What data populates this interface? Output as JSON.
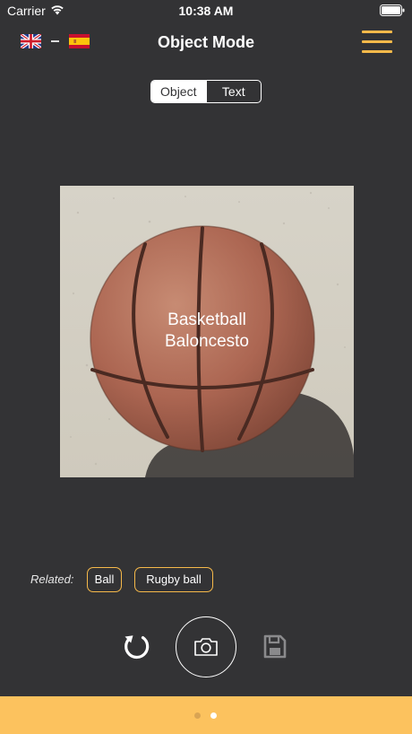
{
  "status_bar": {
    "carrier": "Carrier",
    "time": "10:38 AM"
  },
  "nav": {
    "title": "Object Mode",
    "source_language_flag": "uk-flag",
    "target_language_flag": "spain-flag"
  },
  "mode_tabs": [
    {
      "label": "Object",
      "selected": true
    },
    {
      "label": "Text",
      "selected": false
    }
  ],
  "photo": {
    "caption_source": "Basketball",
    "caption_target": "Baloncesto",
    "subject": "basketball-photo"
  },
  "related": {
    "label": "Related:",
    "items": [
      "Ball",
      "Rugby ball"
    ]
  },
  "controls": {
    "refresh": "refresh-icon",
    "capture": "camera-icon",
    "save": "save-icon"
  },
  "page_indicator": {
    "pages": 2,
    "current": 2
  },
  "colors": {
    "background": "#333335",
    "accent": "#f6b94a",
    "bottom_bar": "#fcc25e"
  }
}
